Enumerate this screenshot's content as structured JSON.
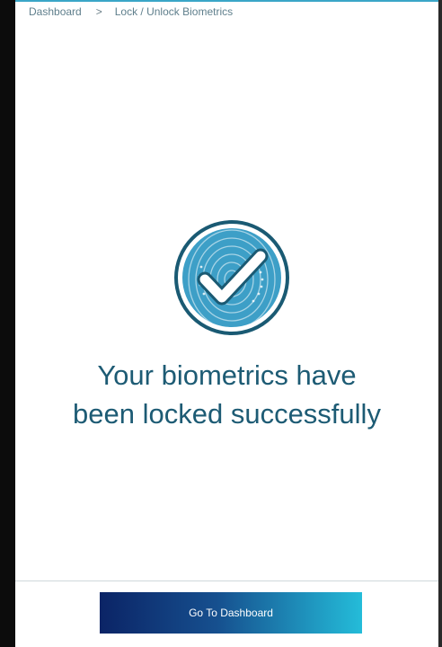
{
  "breadcrumb": {
    "root": "Dashboard",
    "separator": ">",
    "current": "Lock / Unlock Biometrics"
  },
  "status": {
    "icon": "biometric-check-icon",
    "message_line1": "Your biometrics have",
    "message_line2": "been locked successfully"
  },
  "actions": {
    "primary_label": "Go To Dashboard"
  },
  "colors": {
    "accent": "#1d5b74",
    "icon_fill": "#3d9fc7",
    "button_start": "#0b2466",
    "button_end": "#24bcd9"
  }
}
